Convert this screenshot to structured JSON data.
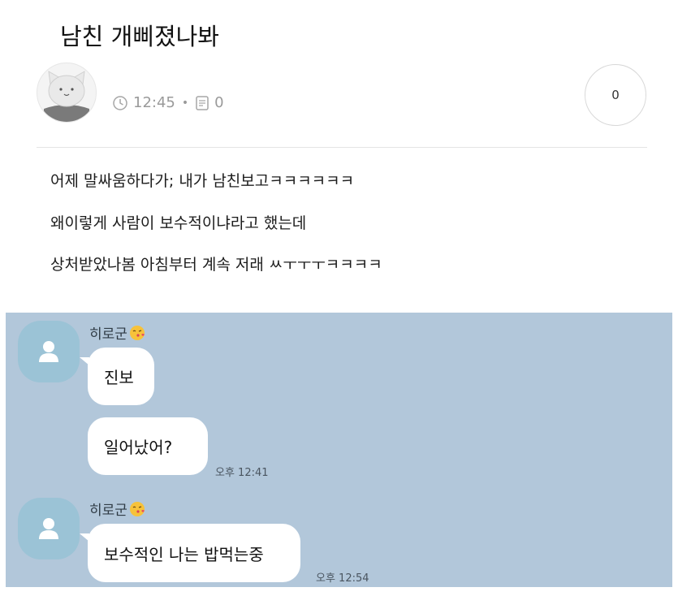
{
  "post": {
    "title": "남친 개삐졌나봐",
    "time": "12:45",
    "comments": "0",
    "count": "0"
  },
  "body_lines": [
    "어제 말싸움하다가; 내가 남친보고ㅋㅋㅋㅋㅋㅋ",
    "왜이렇게 사람이 보수적이냐라고 했는데",
    "상처받았나봄 아침부터 계속 저래 ㅆㅜㅜㅜㅋㅋㅋㅋ"
  ],
  "chat": {
    "groups": [
      {
        "sender": "히로군",
        "messages": [
          {
            "text": "진보",
            "time": ""
          },
          {
            "text": "일어났어?",
            "time": "오후 12:41"
          }
        ]
      },
      {
        "sender": "히로군",
        "messages": [
          {
            "text": "보수적인 나는 밥먹는중",
            "time": "오후 12:54"
          }
        ]
      }
    ]
  },
  "icons": {
    "clock": "clock-icon",
    "comment": "comment-icon",
    "profile": "cat-avatar",
    "chat_profile": "person-icon",
    "sender_emoji": "kiss-face-emoji"
  },
  "colors": {
    "chat_background": "#b2c7da",
    "chat_avatar": "#9bc3d6",
    "bubble": "#ffffff"
  }
}
